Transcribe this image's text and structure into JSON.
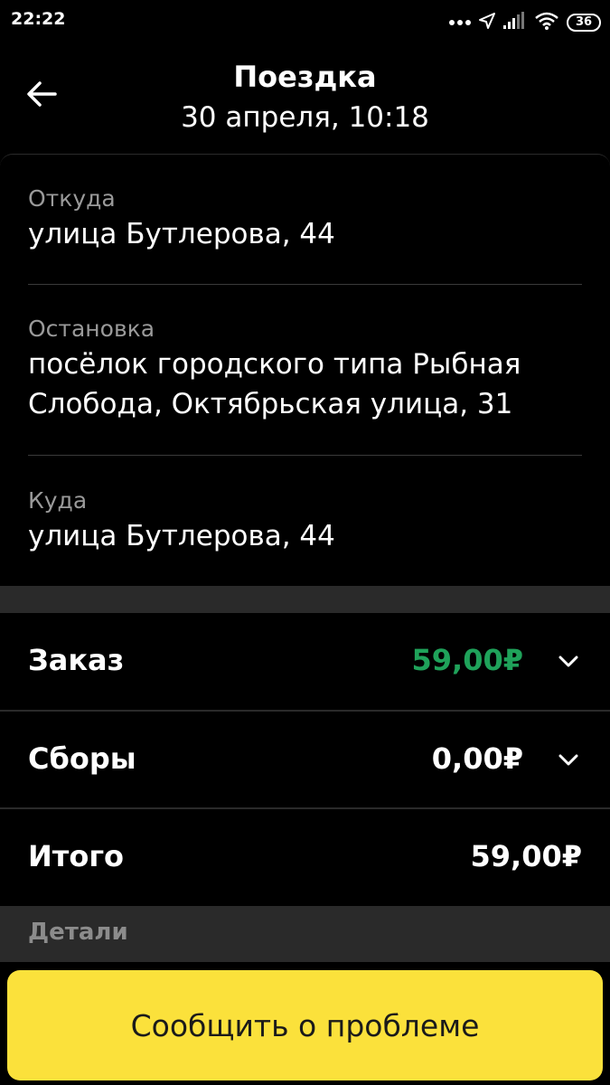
{
  "status_bar": {
    "time": "22:22",
    "battery": "36"
  },
  "header": {
    "title": "Поездка",
    "subtitle": "30 апреля, 10:18"
  },
  "route": {
    "from_label": "Откуда",
    "from_value": "улица Бутлерова, 44",
    "stop_label": "Остановка",
    "stop_value_line1": "посёлок городского типа Рыбная",
    "stop_value_line2": "Слобода, Октябрьская улица, 31",
    "to_label": "Куда",
    "to_value": "улица Бутлерова, 44"
  },
  "prices": {
    "order_label": "Заказ",
    "order_value": "59,00₽",
    "fees_label": "Сборы",
    "fees_value": "0,00₽",
    "total_label": "Итого",
    "total_value": "59,00₽"
  },
  "details": {
    "label": "Детали"
  },
  "actions": {
    "report_label": "Сообщить о проблеме"
  },
  "colors": {
    "accent_yellow": "#fbe13b",
    "price_green": "#1fa25a",
    "background": "#000000"
  }
}
